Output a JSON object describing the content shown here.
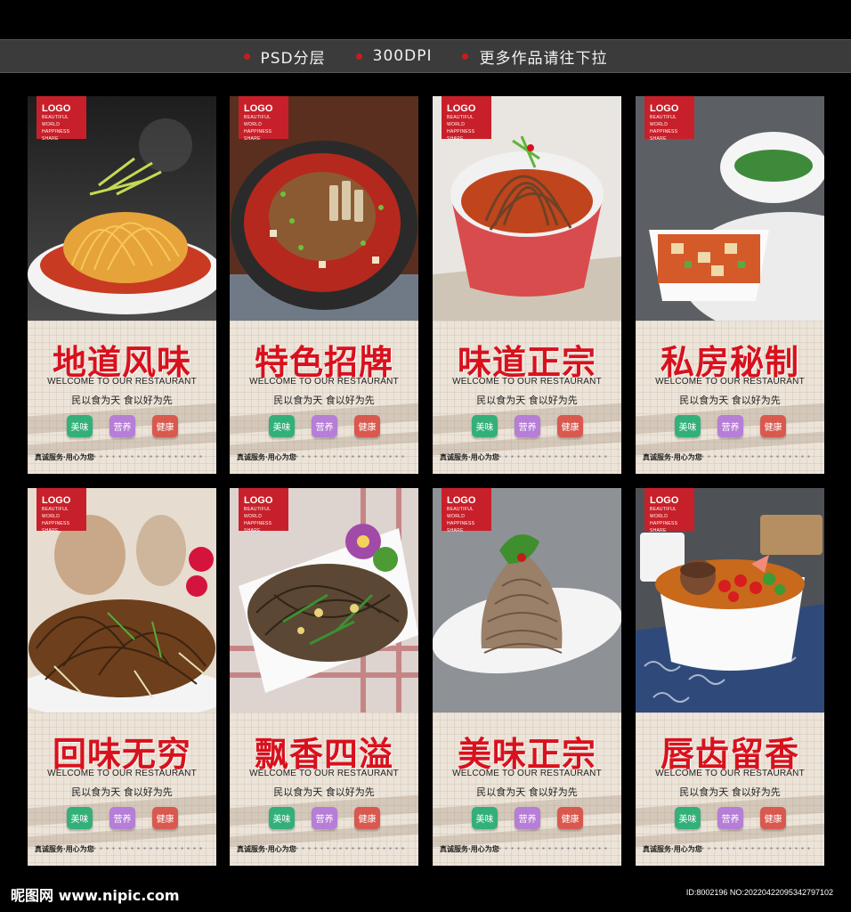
{
  "header": {
    "items": [
      "PSD分层",
      "300DPI",
      "更多作品请往下拉"
    ]
  },
  "cards": [
    {
      "title": "地道风味",
      "logo": "LOGO",
      "logo_sub": [
        "BEAUTIFUL WORLD",
        "HAPPINESS",
        "SHARE"
      ],
      "welcome": "WELCOME TO OUR RESTAURANT",
      "slogan": "民以食为天 食以好为先",
      "tags": [
        "美味",
        "营养",
        "健康"
      ],
      "service": "真诚服务·用心为您"
    },
    {
      "title": "特色招牌",
      "logo": "LOGO",
      "logo_sub": [
        "BEAUTIFUL WORLD",
        "HAPPINESS",
        "SHARE"
      ],
      "welcome": "WELCOME TO OUR RESTAURANT",
      "slogan": "民以食为天 食以好为先",
      "tags": [
        "美味",
        "营养",
        "健康"
      ],
      "service": "真诚服务·用心为您"
    },
    {
      "title": "味道正宗",
      "logo": "LOGO",
      "logo_sub": [
        "BEAUTIFUL WORLD",
        "HAPPINESS",
        "SHARE"
      ],
      "welcome": "WELCOME TO OUR RESTAURANT",
      "slogan": "民以食为天 食以好为先",
      "tags": [
        "美味",
        "营养",
        "健康"
      ],
      "service": "真诚服务·用心为您"
    },
    {
      "title": "私房秘制",
      "logo": "LOGO",
      "logo_sub": [
        "BEAUTIFUL WORLD",
        "HAPPINESS",
        "SHARE"
      ],
      "welcome": "WELCOME TO OUR RESTAURANT",
      "slogan": "民以食为天 食以好为先",
      "tags": [
        "美味",
        "营养",
        "健康"
      ],
      "service": "真诚服务·用心为您"
    },
    {
      "title": "回味无穷",
      "logo": "LOGO",
      "logo_sub": [
        "BEAUTIFUL WORLD",
        "HAPPINESS",
        "SHARE"
      ],
      "welcome": "WELCOME TO OUR RESTAURANT",
      "slogan": "民以食为天 食以好为先",
      "tags": [
        "美味",
        "营养",
        "健康"
      ],
      "service": "真诚服务·用心为您"
    },
    {
      "title": "飘香四溢",
      "logo": "LOGO",
      "logo_sub": [
        "BEAUTIFUL WORLD",
        "HAPPINESS",
        "SHARE"
      ],
      "welcome": "WELCOME TO OUR RESTAURANT",
      "slogan": "民以食为天 食以好为先",
      "tags": [
        "美味",
        "营养",
        "健康"
      ],
      "service": "真诚服务·用心为您"
    },
    {
      "title": "美味正宗",
      "logo": "LOGO",
      "logo_sub": [
        "BEAUTIFUL WORLD",
        "HAPPINESS",
        "SHARE"
      ],
      "welcome": "WELCOME TO OUR RESTAURANT",
      "slogan": "民以食为天 食以好为先",
      "tags": [
        "美味",
        "营养",
        "健康"
      ],
      "service": "真诚服务·用心为您"
    },
    {
      "title": "唇齿留香",
      "logo": "LOGO",
      "logo_sub": [
        "BEAUTIFUL WORLD",
        "HAPPINESS",
        "SHARE"
      ],
      "welcome": "WELCOME TO OUR RESTAURANT",
      "slogan": "民以食为天 食以好为先",
      "tags": [
        "美味",
        "营养",
        "健康"
      ],
      "service": "真诚服务·用心为您"
    }
  ],
  "footer": {
    "watermark": "昵图网 www.nipic.com",
    "id_text": "ID:8002196 NO:20220422095342797102"
  },
  "colors": {
    "title_red": "#d8111d",
    "logo_red": "#c8202a",
    "tag_green": "#33b07a",
    "tag_purple": "#b67ed6",
    "tag_red": "#d9594f"
  }
}
